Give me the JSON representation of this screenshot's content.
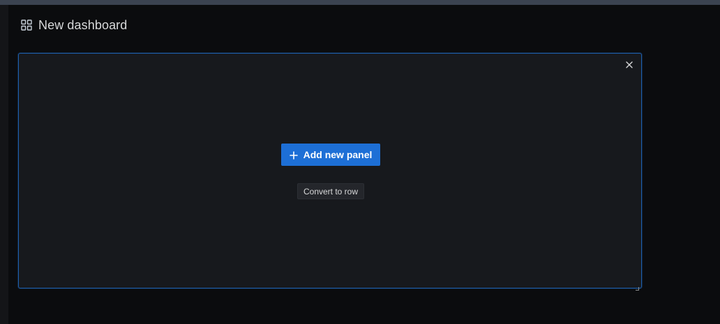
{
  "header": {
    "icon": "dashboard-grid-icon",
    "title": "New dashboard"
  },
  "panel": {
    "add_button_label": "Add new panel",
    "add_button_icon": "plus-icon",
    "convert_button_label": "Convert to row",
    "close_icon": "close-icon",
    "resize_icon": "resize-handle-icon"
  },
  "colors": {
    "background": "#0b0c0e",
    "panel_background": "#17191d",
    "panel_border": "#1e5fad",
    "primary_button": "#1d6fd6",
    "text": "#d8d9da"
  }
}
